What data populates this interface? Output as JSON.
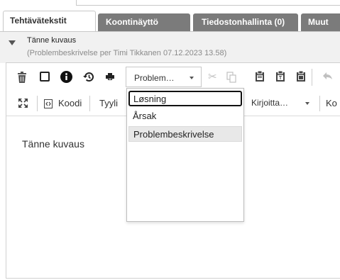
{
  "tabs": [
    {
      "label": "Tehtävätekstit",
      "active": true
    },
    {
      "label": "Koontinäyttö",
      "active": false
    },
    {
      "label": "Tiedostonhallinta (0)",
      "active": false
    },
    {
      "label": "Muut",
      "active": false
    }
  ],
  "section": {
    "title": "Tänne kuvaus",
    "subtitle": "(Problembeskrivelse per Timi Tikkanen 07.12.2023 13.58)"
  },
  "toolbar": {
    "format_select_value": "Problem…",
    "source_label": "Koodi",
    "style_label": "Tyyli",
    "font_label": "Kirjoitta…",
    "size_label": "Ko"
  },
  "dropdown": {
    "options": [
      {
        "label": "Løsning",
        "state": "focused"
      },
      {
        "label": "Årsak",
        "state": "normal"
      },
      {
        "label": "Problembeskrivelse",
        "state": "selected"
      }
    ]
  },
  "editor": {
    "text": "Tänne kuvaus"
  },
  "colors": {
    "tab_inactive": "#7b7b7b",
    "header_bg": "#f1f1f1",
    "disabled_icon": "#c0c0c0"
  },
  "icons": [
    "trash-icon",
    "checkbox-icon",
    "info-icon",
    "history-icon",
    "print-icon",
    "cut-icon",
    "copy-icon",
    "paste-icon",
    "paste-text-icon",
    "paste-word-icon",
    "undo-icon",
    "maximize-icon",
    "source-code-icon"
  ]
}
